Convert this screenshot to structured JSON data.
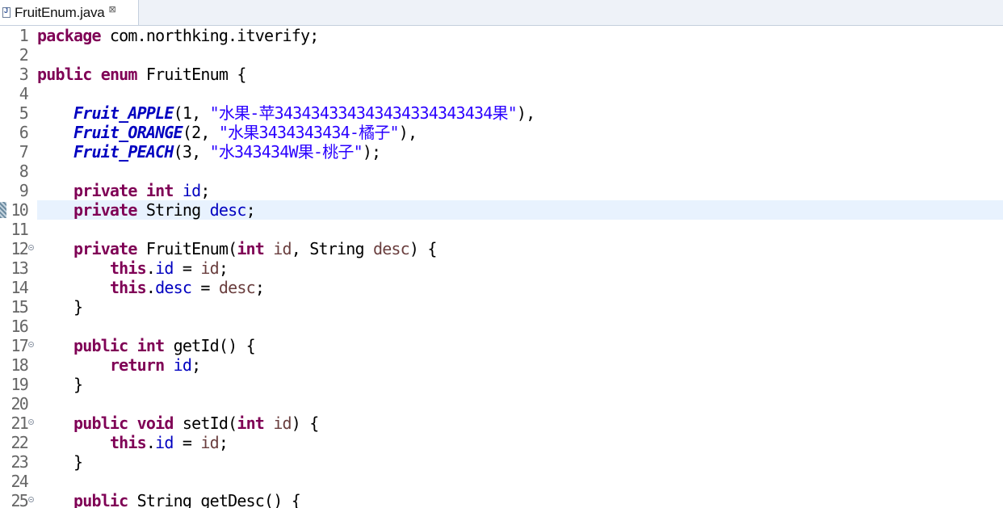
{
  "tab": {
    "title": "FruitEnum.java",
    "close_symbol": "⊠"
  },
  "editor": {
    "current_line": 10,
    "lines": [
      {
        "num": "1",
        "tokens": [
          [
            "kw",
            "package"
          ],
          [
            "",
            "␣com.northking.itverify;"
          ]
        ]
      },
      {
        "num": "2",
        "tokens": []
      },
      {
        "num": "3",
        "tokens": [
          [
            "kw",
            "public"
          ],
          [
            "",
            "␣"
          ],
          [
            "kw",
            "enum"
          ],
          [
            "",
            "␣FruitEnum␣{"
          ]
        ]
      },
      {
        "num": "4",
        "tokens": []
      },
      {
        "num": "5",
        "tokens": [
          [
            "",
            "␣␣␣␣"
          ],
          [
            "enumc",
            "Fruit_APPLE"
          ],
          [
            "",
            "(1,␣"
          ],
          [
            "str",
            "\"水果-苹343434334343434334343434果\""
          ],
          [
            "",
            "),"
          ]
        ]
      },
      {
        "num": "6",
        "tokens": [
          [
            "",
            "␣␣␣␣"
          ],
          [
            "enumc",
            "Fruit_ORANGE"
          ],
          [
            "",
            "(2,␣"
          ],
          [
            "str",
            "\"水果3434343434-橘子\""
          ],
          [
            "",
            "),"
          ]
        ]
      },
      {
        "num": "7",
        "tokens": [
          [
            "",
            "␣␣␣␣"
          ],
          [
            "enumc",
            "Fruit_PEACH"
          ],
          [
            "",
            "(3,␣"
          ],
          [
            "str",
            "\"水343434W果-桃子\""
          ],
          [
            "",
            ");"
          ]
        ]
      },
      {
        "num": "8",
        "tokens": []
      },
      {
        "num": "9",
        "tokens": [
          [
            "",
            "␣␣␣␣"
          ],
          [
            "kw",
            "private"
          ],
          [
            "",
            "␣"
          ],
          [
            "kw",
            "int"
          ],
          [
            "",
            "␣"
          ],
          [
            "fld",
            "id"
          ],
          [
            "",
            ";"
          ]
        ]
      },
      {
        "num": "10",
        "tokens": [
          [
            "",
            "␣␣␣␣"
          ],
          [
            "kw",
            "private"
          ],
          [
            "",
            "␣String␣"
          ],
          [
            "fld",
            "desc"
          ],
          [
            "",
            ";"
          ]
        ]
      },
      {
        "num": "11",
        "tokens": []
      },
      {
        "num": "12",
        "fold": true,
        "tokens": [
          [
            "",
            "␣␣␣␣"
          ],
          [
            "kw",
            "private"
          ],
          [
            "",
            "␣FruitEnum("
          ],
          [
            "kw",
            "int"
          ],
          [
            "",
            "␣"
          ],
          [
            "par",
            "id"
          ],
          [
            "",
            ",␣String␣"
          ],
          [
            "par",
            "desc"
          ],
          [
            "",
            ")␣{"
          ]
        ]
      },
      {
        "num": "13",
        "tokens": [
          [
            "",
            "␣␣␣␣␣␣␣␣"
          ],
          [
            "kw",
            "this"
          ],
          [
            "",
            "."
          ],
          [
            "fld",
            "id"
          ],
          [
            "",
            "␣=␣"
          ],
          [
            "par",
            "id"
          ],
          [
            "",
            ";"
          ]
        ]
      },
      {
        "num": "14",
        "tokens": [
          [
            "",
            "␣␣␣␣␣␣␣␣"
          ],
          [
            "kw",
            "this"
          ],
          [
            "",
            "."
          ],
          [
            "fld",
            "desc"
          ],
          [
            "",
            "␣=␣"
          ],
          [
            "par",
            "desc"
          ],
          [
            "",
            ";"
          ]
        ]
      },
      {
        "num": "15",
        "tokens": [
          [
            "",
            "␣␣␣␣}"
          ]
        ]
      },
      {
        "num": "16",
        "tokens": []
      },
      {
        "num": "17",
        "fold": true,
        "tokens": [
          [
            "",
            "␣␣␣␣"
          ],
          [
            "kw",
            "public"
          ],
          [
            "",
            "␣"
          ],
          [
            "kw",
            "int"
          ],
          [
            "",
            "␣getId()␣{"
          ]
        ]
      },
      {
        "num": "18",
        "tokens": [
          [
            "",
            "␣␣␣␣␣␣␣␣"
          ],
          [
            "kw",
            "return"
          ],
          [
            "",
            "␣"
          ],
          [
            "fld",
            "id"
          ],
          [
            "",
            ";"
          ]
        ]
      },
      {
        "num": "19",
        "tokens": [
          [
            "",
            "␣␣␣␣}"
          ]
        ]
      },
      {
        "num": "20",
        "tokens": []
      },
      {
        "num": "21",
        "fold": true,
        "tokens": [
          [
            "",
            "␣␣␣␣"
          ],
          [
            "kw",
            "public"
          ],
          [
            "",
            "␣"
          ],
          [
            "kw",
            "void"
          ],
          [
            "",
            "␣setId("
          ],
          [
            "kw",
            "int"
          ],
          [
            "",
            "␣"
          ],
          [
            "par",
            "id"
          ],
          [
            "",
            ")␣{"
          ]
        ]
      },
      {
        "num": "22",
        "tokens": [
          [
            "",
            "␣␣␣␣␣␣␣␣"
          ],
          [
            "kw",
            "this"
          ],
          [
            "",
            "."
          ],
          [
            "fld",
            "id"
          ],
          [
            "",
            "␣=␣"
          ],
          [
            "par",
            "id"
          ],
          [
            "",
            ";"
          ]
        ]
      },
      {
        "num": "23",
        "tokens": [
          [
            "",
            "␣␣␣␣}"
          ]
        ]
      },
      {
        "num": "24",
        "tokens": []
      },
      {
        "num": "25",
        "fold": true,
        "tokens": [
          [
            "",
            "␣␣␣␣"
          ],
          [
            "kw",
            "public"
          ],
          [
            "",
            "␣String␣getDesc()␣{"
          ]
        ]
      }
    ]
  }
}
